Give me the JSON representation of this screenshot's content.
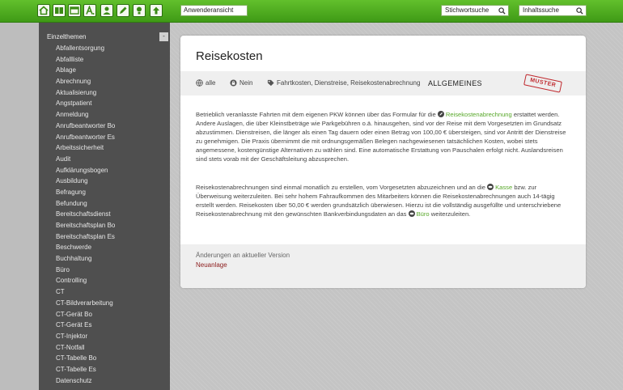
{
  "toolbar": {
    "buttons": [
      {
        "name": "home-icon"
      },
      {
        "name": "book-icon"
      },
      {
        "name": "window-icon"
      },
      {
        "name": "text-a-icon"
      },
      {
        "name": "user-icon"
      },
      {
        "name": "pencil-icon"
      },
      {
        "name": "lightbulb-icon"
      },
      {
        "name": "arrow-up-icon"
      }
    ],
    "view_select": "Anwenderansicht",
    "keyword_search": "Stichwortsuche",
    "content_search": "Inhaltssuche",
    "accent_color": "#4caf22"
  },
  "sidebar": {
    "heading": "Einzelthemen",
    "collapse_label": "-",
    "items": [
      "Abfallentsorgung",
      "Abfallliste",
      "Ablage",
      "Abrechnung",
      "Aktualisierung",
      "Angstpatient",
      "Anmeldung",
      "Anrufbeantworter Bo",
      "Anrufbeantworter Es",
      "Arbeitssicherheit",
      "Audit",
      "Aufklärungsbogen",
      "Ausbildung",
      "Befragung",
      "Befundung",
      "Bereitschaftsdienst",
      "Bereitschaftsplan Bo",
      "Bereitschaftsplan Es",
      "Beschwerde",
      "Buchhaltung",
      "Büro",
      "Controlling",
      "CT",
      "CT-Bildverarbeitung",
      "CT-Gerät Bo",
      "CT-Gerät Es",
      "CT-Injektor",
      "CT-Notfall",
      "CT-Tabelle Bo",
      "CT-Tabelle Es",
      "Datenschutz"
    ]
  },
  "document": {
    "title": "Reisekosten",
    "meta": {
      "scope": "alle",
      "confidential": "Nein",
      "tags": "Fahrtkosten, Dienstreise, Reisekostenabrechnung",
      "category": "ALLGEMEINES",
      "stamp": "MUSTER"
    },
    "para1": {
      "before": "Betrieblich veranlasste Fahrten mit dem eigenen PKW können über das Formular für die ",
      "link": "Reisekostenabrechnung",
      "after": " erstattet werden. Andere Auslagen, die über Kleinstbeträge wie Parkgebühren o.ä. hinausgehen, sind vor der Reise mit dem Vorgesetzten im Grundsatz abzustimmen. Dienstreisen, die länger als einen Tag dauern oder einen Betrag von 100,00 € übersteigen, sind vor Antritt der Dienstreise zu genehmigen. Die Praxis übernimmt die mit ordnungsgemäßen Belegen nachgewiesenen tatsächlichen Kosten, wobei stets angemessene, kostengünstige Alternativen zu wählen sind. Eine automatische Erstattung von Pauschalen erfolgt nicht. Auslandsreisen sind stets vorab mit der Geschäftsleitung abzusprechen."
    },
    "para2": {
      "before": "Reisekostenabrechnungen sind einmal monatlich zu erstellen, vom Vorgesetzten abzuzeichnen und an die ",
      "link1": "Kasse",
      "middle": " bzw. zur Überweisung weiterzuleiten. Bei sehr hohem Fahraufkommen des Mitarbeiters können die Reisekostenabrechnungen auch 14-tägig erstellt werden. Reisekosten über 50,00 € werden grundsätzlich überwiesen. Hierzu ist die vollständig ausgefüllte und unterschriebene Reisekostenabrechnung mit den gewünschten Bankverbindungsdaten an das ",
      "link2": "Büro",
      "after": " weiterzuleiten."
    },
    "changes": {
      "label": "Änderungen an aktueller Version",
      "value": "Neuanlage"
    }
  }
}
